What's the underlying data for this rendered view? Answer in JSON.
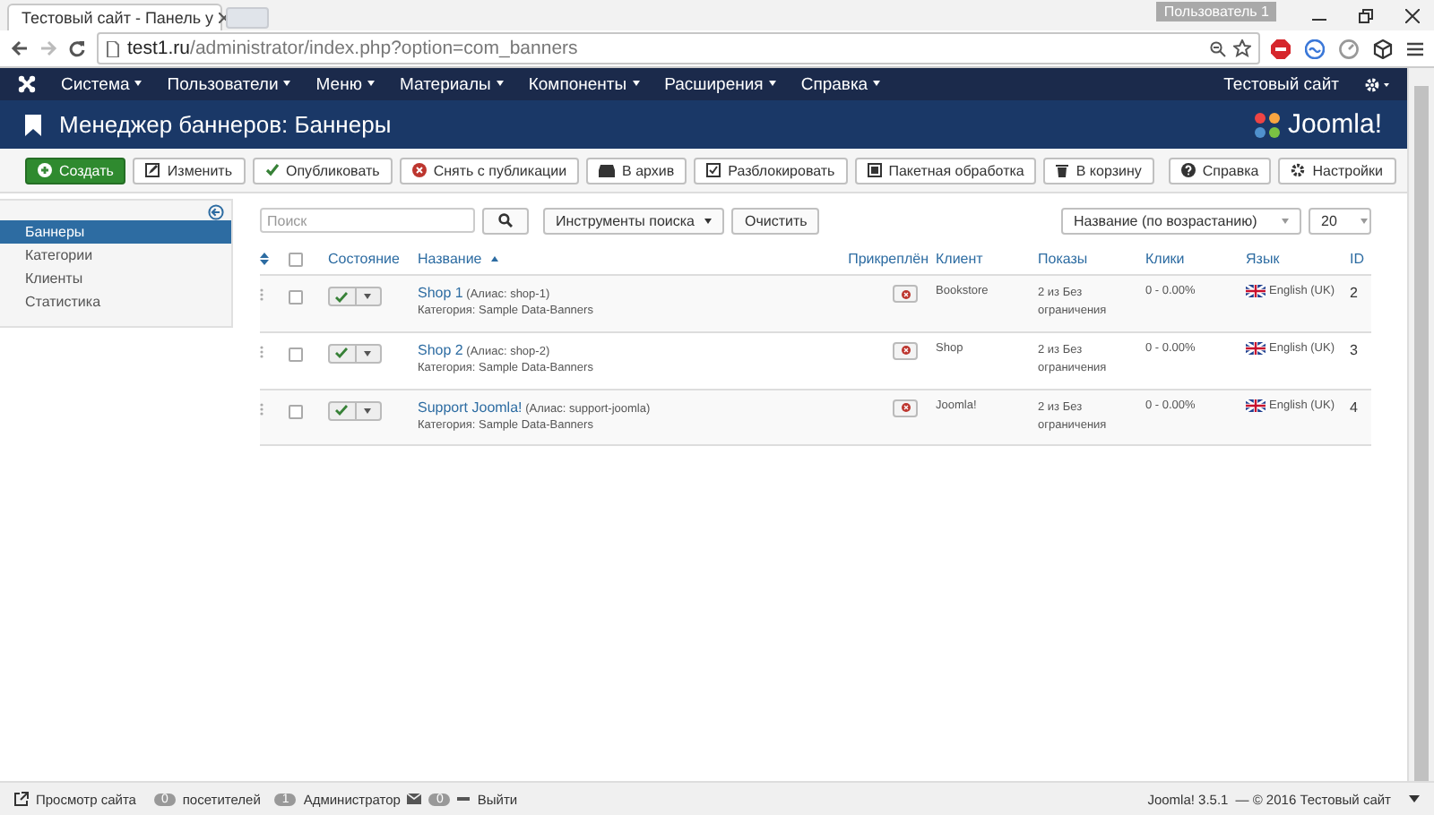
{
  "browser": {
    "tab_title": "Тестовый сайт - Панель у",
    "user_badge": "Пользователь 1",
    "url_host": "test1.ru",
    "url_path": "/administrator/index.php?option=com_banners"
  },
  "nav": {
    "menus": [
      "Система",
      "Пользователи",
      "Меню",
      "Материалы",
      "Компоненты",
      "Расширения",
      "Справка"
    ],
    "site_link": "Тестовый сайт"
  },
  "header": {
    "title": "Менеджер баннеров: Баннеры",
    "logo": "Joomla!"
  },
  "toolbar": {
    "buttons": [
      {
        "label": "Создать",
        "kind": "primary"
      },
      {
        "label": "Изменить",
        "kind": "default"
      },
      {
        "label": "Опубликовать",
        "kind": "default"
      },
      {
        "label": "Снять с публикации",
        "kind": "default"
      },
      {
        "label": "В архив",
        "kind": "default"
      },
      {
        "label": "Разблокировать",
        "kind": "default"
      },
      {
        "label": "Пакетная обработка",
        "kind": "default"
      },
      {
        "label": "В корзину",
        "kind": "default"
      }
    ],
    "right_buttons": [
      {
        "label": "Справка"
      },
      {
        "label": "Настройки"
      }
    ]
  },
  "sidebar": {
    "items": [
      {
        "label": "Баннеры",
        "selected": true
      },
      {
        "label": "Категории",
        "selected": false
      },
      {
        "label": "Клиенты",
        "selected": false
      },
      {
        "label": "Статистика",
        "selected": false
      }
    ]
  },
  "filters": {
    "search": {
      "placeholder": "Поиск"
    },
    "tools_button": "Инструменты поиска",
    "clear_button": "Очистить",
    "sort": "Название (по возрастанию)",
    "limit": "20"
  },
  "table": {
    "select_all_checked": false,
    "columns": [
      "Состояние",
      "Название",
      "Прикреплён",
      "Клиент",
      "Показы",
      "Клики",
      "Язык",
      "ID"
    ],
    "rows": [
      {
        "checked": false,
        "published": true,
        "title": "Shop 1",
        "alias": "(Алиас: shop-1)",
        "category": "Категория: Sample Data-Banners",
        "client": "Bookstore",
        "impressions": "2 из Без ограничения",
        "clicks": "0 - 0.00%",
        "language": "English (UK)",
        "id": "2"
      },
      {
        "checked": false,
        "published": true,
        "title": "Shop 2",
        "alias": "(Алиас: shop-2)",
        "category": "Категория: Sample Data-Banners",
        "client": "Shop",
        "impressions": "2 из Без ограничения",
        "clicks": "0 - 0.00%",
        "language": "English (UK)",
        "id": "3"
      },
      {
        "checked": false,
        "published": true,
        "title": "Support Joomla!",
        "alias": "(Алиас: support-joomla)",
        "category": "Категория: Sample Data-Banners",
        "client": "Joomla!",
        "impressions": "2 из Без ограничения",
        "clicks": "0 - 0.00%",
        "language": "English (UK)",
        "id": "4"
      }
    ]
  },
  "status_bar": {
    "view_site": "Просмотр сайта",
    "visitors_count": "0",
    "visitors": "посетителей",
    "admins_count": "1",
    "admins": "Администратор",
    "messages_count": "0",
    "logout": "Выйти",
    "version": "Joomla! 3.5.1",
    "copyright": "— © 2016 Тестовый сайт"
  }
}
